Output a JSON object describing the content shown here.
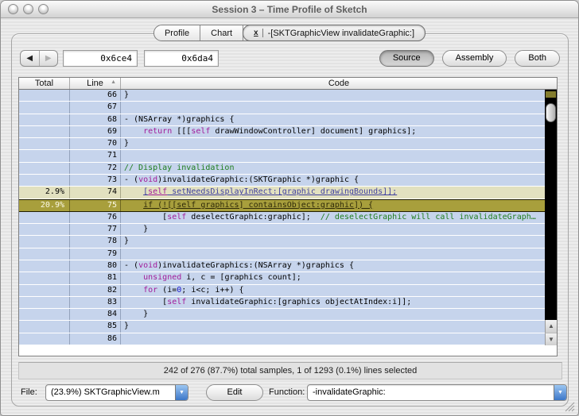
{
  "window": {
    "title": "Session 3 – Time Profile of Sketch"
  },
  "tabs": {
    "items": [
      {
        "label": "Profile",
        "active": false,
        "closable": false
      },
      {
        "label": "Chart",
        "active": false,
        "closable": false
      },
      {
        "label": "-[SKTGraphicView invalidateGraphic:]",
        "active": true,
        "closable": true
      }
    ]
  },
  "toolbar": {
    "back_icon": "◀",
    "forward_icon": "▶",
    "address_start": "0x6ce4",
    "address_end": "0x6da4",
    "view_buttons": [
      {
        "label": "Source",
        "selected": true
      },
      {
        "label": "Assembly",
        "selected": false
      },
      {
        "label": "Both",
        "selected": false
      }
    ]
  },
  "table": {
    "columns": [
      "Total",
      "Line",
      "Code"
    ],
    "sort_column": "Line",
    "sort_ascending": true,
    "rows": [
      {
        "total": "",
        "line": "66",
        "state": "normal",
        "code": [
          {
            "t": "}",
            "c": "plain"
          }
        ]
      },
      {
        "total": "",
        "line": "67",
        "state": "normal",
        "code": []
      },
      {
        "total": "",
        "line": "68",
        "state": "normal",
        "code": [
          {
            "t": "- (NSArray *)graphics {",
            "c": "plain"
          }
        ]
      },
      {
        "total": "",
        "line": "69",
        "state": "normal",
        "code": [
          {
            "t": "    ",
            "c": "plain"
          },
          {
            "t": "return",
            "c": "kw"
          },
          {
            "t": " [[[",
            "c": "plain"
          },
          {
            "t": "self",
            "c": "kw"
          },
          {
            "t": " drawWindowController] document] graphics];",
            "c": "plain"
          }
        ]
      },
      {
        "total": "",
        "line": "70",
        "state": "normal",
        "code": [
          {
            "t": "}",
            "c": "plain"
          }
        ]
      },
      {
        "total": "",
        "line": "71",
        "state": "normal",
        "code": []
      },
      {
        "total": "",
        "line": "72",
        "state": "normal",
        "code": [
          {
            "t": "// Display invalidation",
            "c": "comment"
          }
        ]
      },
      {
        "total": "",
        "line": "73",
        "state": "normal",
        "code": [
          {
            "t": "- (",
            "c": "plain"
          },
          {
            "t": "void",
            "c": "kw"
          },
          {
            "t": ")invalidateGraphic:(SKTGraphic *)graphic {",
            "c": "plain"
          }
        ]
      },
      {
        "total": "2.9%",
        "line": "74",
        "state": "hot",
        "code": [
          {
            "t": "    ",
            "c": "plain"
          },
          {
            "t": "[",
            "c": "link"
          },
          {
            "t": "self",
            "c": "kwlink"
          },
          {
            "t": " setNeedsDisplayInRect:[graphic drawingBounds]];",
            "c": "link"
          }
        ]
      },
      {
        "total": "20.9%",
        "line": "75",
        "state": "selected",
        "code": [
          {
            "t": "    ",
            "c": "plain"
          },
          {
            "t": "if (![[self graphics] containsObject:graphic]) {",
            "c": "sellink"
          }
        ]
      },
      {
        "total": "",
        "line": "76",
        "state": "normal",
        "code": [
          {
            "t": "        [",
            "c": "plain"
          },
          {
            "t": "self",
            "c": "kw"
          },
          {
            "t": " deselectGraphic:graphic];  ",
            "c": "plain"
          },
          {
            "t": "// deselectGraphic will call invalidateGraph…",
            "c": "comment"
          }
        ]
      },
      {
        "total": "",
        "line": "77",
        "state": "normal",
        "code": [
          {
            "t": "    }",
            "c": "plain"
          }
        ]
      },
      {
        "total": "",
        "line": "78",
        "state": "normal",
        "code": [
          {
            "t": "}",
            "c": "plain"
          }
        ]
      },
      {
        "total": "",
        "line": "79",
        "state": "normal",
        "code": []
      },
      {
        "total": "",
        "line": "80",
        "state": "normal",
        "code": [
          {
            "t": "- (",
            "c": "plain"
          },
          {
            "t": "void",
            "c": "kw"
          },
          {
            "t": ")invalidateGraphics:(NSArray *)graphics {",
            "c": "plain"
          }
        ]
      },
      {
        "total": "",
        "line": "81",
        "state": "normal",
        "code": [
          {
            "t": "    ",
            "c": "plain"
          },
          {
            "t": "unsigned",
            "c": "kw"
          },
          {
            "t": " i, c = [graphics count];",
            "c": "plain"
          }
        ]
      },
      {
        "total": "",
        "line": "82",
        "state": "normal",
        "code": [
          {
            "t": "    ",
            "c": "plain"
          },
          {
            "t": "for",
            "c": "kw"
          },
          {
            "t": " (i=",
            "c": "plain"
          },
          {
            "t": "0",
            "c": "num"
          },
          {
            "t": "; i<c; i++) {",
            "c": "plain"
          }
        ]
      },
      {
        "total": "",
        "line": "83",
        "state": "normal",
        "code": [
          {
            "t": "        [",
            "c": "plain"
          },
          {
            "t": "self",
            "c": "kw"
          },
          {
            "t": " invalidateGraphic:[graphics objectAtIndex:i]];",
            "c": "plain"
          }
        ]
      },
      {
        "total": "",
        "line": "84",
        "state": "normal",
        "code": [
          {
            "t": "    }",
            "c": "plain"
          }
        ]
      },
      {
        "total": "",
        "line": "85",
        "state": "normal",
        "code": [
          {
            "t": "}",
            "c": "plain"
          }
        ]
      },
      {
        "total": "",
        "line": "86",
        "state": "normal",
        "code": []
      }
    ]
  },
  "status": {
    "text": "242 of 276 (87.7%) total samples, 1 of 1293 (0.1%) lines selected"
  },
  "footer": {
    "file_label": "File:",
    "file_value": "(23.9%) SKTGraphicView.m",
    "edit_label": "Edit",
    "function_label": "Function:",
    "function_value": "-invalidateGraphic:"
  },
  "colors": {
    "row_blue": "#c6d4ec",
    "hot_row_khaki": "#e2e1c0",
    "selected_row_olive": "#a89f3c",
    "syntax_keyword": "#a21c9a",
    "syntax_comment": "#1e7d1e",
    "syntax_number": "#1717c9",
    "link_underline": "#41419f",
    "popup_arrow_blue": "#3c77c8"
  }
}
